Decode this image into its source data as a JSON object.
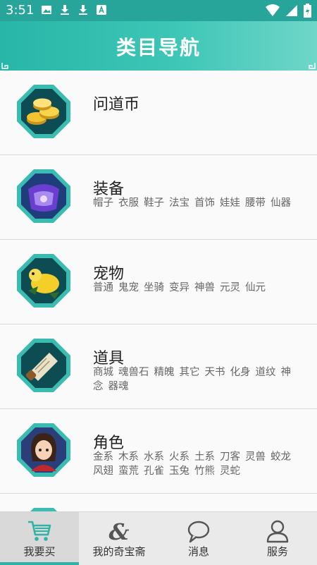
{
  "status_bar": {
    "time": "3:51",
    "accent": "#27a59a"
  },
  "header": {
    "title": "类目导航"
  },
  "categories": [
    {
      "name": "问道币",
      "icon": "coins-icon",
      "subs": []
    },
    {
      "name": "装备",
      "icon": "equipment-icon",
      "subs": [
        "帽子",
        "衣服",
        "鞋子",
        "法宝",
        "首饰",
        "娃娃",
        "腰带",
        "仙器"
      ]
    },
    {
      "name": "宠物",
      "icon": "pet-icon",
      "subs": [
        "普通",
        "鬼宠",
        "坐骑",
        "变异",
        "神兽",
        "元灵",
        "仙元"
      ]
    },
    {
      "name": "道具",
      "icon": "scroll-icon",
      "subs": [
        "商城",
        "魂兽石",
        "精魄",
        "其它",
        "天书",
        "化身",
        "道纹",
        "神念",
        "器魂"
      ]
    },
    {
      "name": "角色",
      "icon": "character-icon",
      "subs": [
        "金系",
        "木系",
        "水系",
        "火系",
        "土系",
        "刀客",
        "灵兽",
        "蛟龙",
        "风翅",
        "蛮荒",
        "孔雀",
        "玉兔",
        "竹熊",
        "灵蛇"
      ]
    }
  ],
  "tabs": [
    {
      "label": "我要买",
      "icon": "cart-icon",
      "active": true
    },
    {
      "label": "我的奇宝斋",
      "icon": "ampersand-icon",
      "active": false
    },
    {
      "label": "消息",
      "icon": "chat-bubble-icon",
      "active": false
    },
    {
      "label": "服务",
      "icon": "person-icon",
      "active": false
    }
  ],
  "colors": {
    "teal": "#2fb3a6",
    "badge_border": "#3bbcb0",
    "badge_fill": "#0d4c52"
  }
}
